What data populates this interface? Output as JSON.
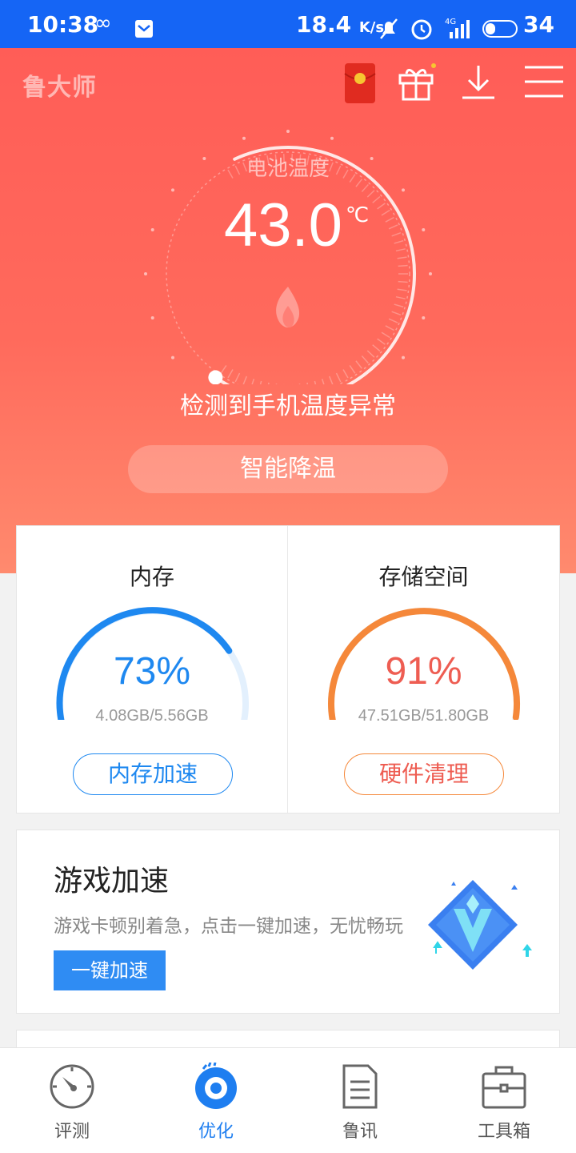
{
  "status_bar": {
    "time": "10:38",
    "speed": "18.4",
    "speed_unit": "K/s",
    "battery": "34",
    "battery_level": 0.34,
    "network": "4G"
  },
  "header": {
    "logo": "鲁大师"
  },
  "battery_temp": {
    "label": "电池温度",
    "value": "43.0",
    "unit": "℃",
    "alert": "检测到手机温度异常",
    "action": "智能降温"
  },
  "memory": {
    "title": "内存",
    "percent": "73%",
    "level": 0.73,
    "size": "4.08GB/5.56GB",
    "action": "内存加速",
    "color": "#1e88f0"
  },
  "storage": {
    "title": "存储空间",
    "percent": "91%",
    "level": 0.91,
    "size": "47.51GB/51.80GB",
    "action": "硬件清理",
    "color": "#f5883a"
  },
  "game": {
    "title": "游戏加速",
    "desc": "游戏卡顿别着急，点击一键加速，无忧畅玩",
    "action": "一键加速"
  },
  "nav": {
    "items": [
      {
        "label": "评测",
        "icon": "speedometer-icon"
      },
      {
        "label": "优化",
        "icon": "optimize-icon"
      },
      {
        "label": "鲁讯",
        "icon": "news-icon"
      },
      {
        "label": "工具箱",
        "icon": "toolbox-icon"
      }
    ],
    "active": 1
  }
}
